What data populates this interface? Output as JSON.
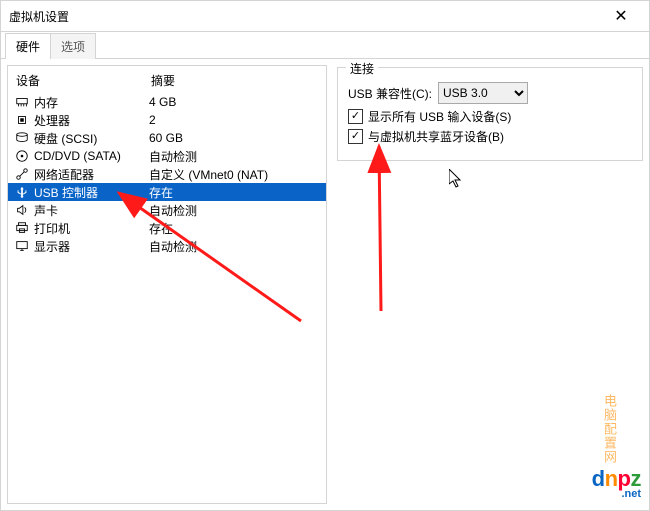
{
  "window": {
    "title": "虚拟机设置",
    "close_label": "✕"
  },
  "tabs": {
    "hardware": "硬件",
    "options": "选项"
  },
  "columns": {
    "device": "设备",
    "summary": "摘要"
  },
  "devices": [
    {
      "icon": "memory-icon",
      "label": "内存",
      "summary": "4 GB"
    },
    {
      "icon": "cpu-icon",
      "label": "处理器",
      "summary": "2"
    },
    {
      "icon": "disk-icon",
      "label": "硬盘 (SCSI)",
      "summary": "60 GB"
    },
    {
      "icon": "disc-icon",
      "label": "CD/DVD (SATA)",
      "summary": "自动检测"
    },
    {
      "icon": "network-icon",
      "label": "网络适配器",
      "summary": "自定义 (VMnet0 (NAT)"
    },
    {
      "icon": "usb-icon",
      "label": "USB 控制器",
      "summary": "存在",
      "selected": true
    },
    {
      "icon": "sound-icon",
      "label": "声卡",
      "summary": "自动检测"
    },
    {
      "icon": "printer-icon",
      "label": "打印机",
      "summary": "存在"
    },
    {
      "icon": "display-icon",
      "label": "显示器",
      "summary": "自动检测"
    }
  ],
  "right": {
    "group_title": "连接",
    "compat_label": "USB 兼容性(C):",
    "compat_value": "USB 3.0",
    "show_all_usb": "显示所有 USB 输入设备(S)",
    "share_bluetooth": "与虚拟机共享蓝牙设备(B)"
  },
  "watermark": {
    "brand": "dnpz",
    "domain": ".net",
    "cn": "电脑配置网"
  }
}
